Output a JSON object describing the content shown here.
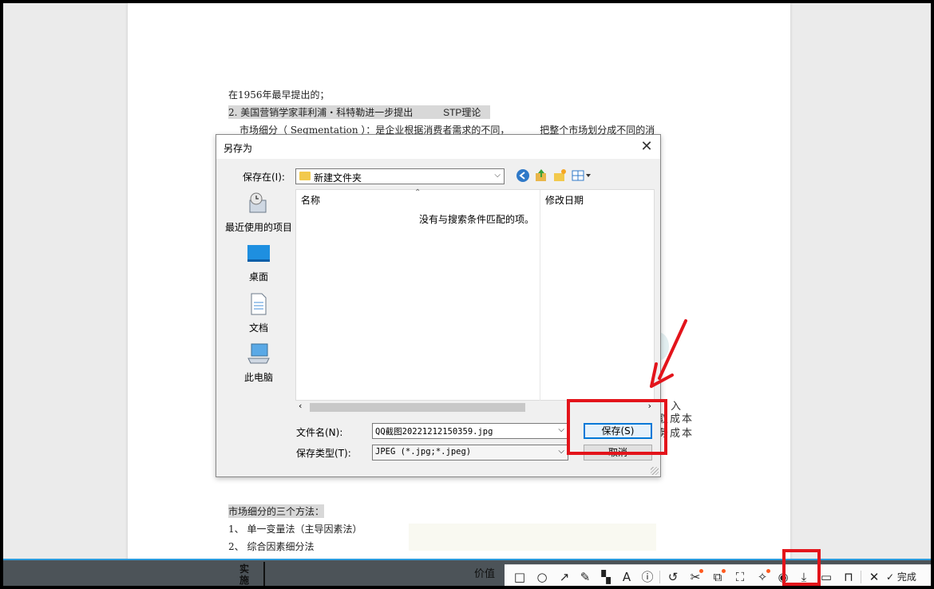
{
  "document": {
    "lines": [
      "在1956年最早提出的；",
      "2. 美国营销学家菲利浦・科特勒进一步提出",
      "STP理论",
      "市场细分（  Segmentation  ）：是企业根据消费者需求的不同，",
      "把整个市场划分成不同的消",
      "市场细分的三个方法：",
      "1、  单一变量法（主导因素法）",
      "2、  综合因素细分法"
    ],
    "right_fragments": [
      "入",
      "取成本",
      "务成本"
    ],
    "strip_chars": [
      "实",
      "施",
      "价值"
    ]
  },
  "dialog": {
    "title": "另存为",
    "save_in_label": "保存在(I):",
    "save_in_value": "新建文件夹",
    "places": [
      "最近使用的项目",
      "桌面",
      "文档",
      "此电脑"
    ],
    "columns": {
      "name": "名称",
      "date": "修改日期"
    },
    "empty_message": "没有与搜索条件匹配的项。",
    "filename_label": "文件名(N):",
    "filename_value": "QQ截图20221212150359.jpg",
    "filetype_label": "保存类型(T):",
    "filetype_value": "JPEG (*.jpg;*.jpeg)",
    "save_button": "保存(S)",
    "cancel_button": "取消"
  },
  "toolbar": {
    "done_label": "完成",
    "tools": [
      "rectangle-icon",
      "ellipse-icon",
      "arrow-icon",
      "pen-icon",
      "mosaic-icon",
      "text-icon",
      "number-icon",
      "undo-icon",
      "crop-icon",
      "translate-icon",
      "ocr-icon",
      "pin-icon",
      "screenshot-record-icon",
      "download-icon",
      "save-icon",
      "bookmark-icon",
      "close-icon",
      "check-icon"
    ]
  },
  "colors": {
    "accent": "#0078d7",
    "highlight_red": "#e3141b",
    "strip_blue": "#2d9bdc"
  }
}
